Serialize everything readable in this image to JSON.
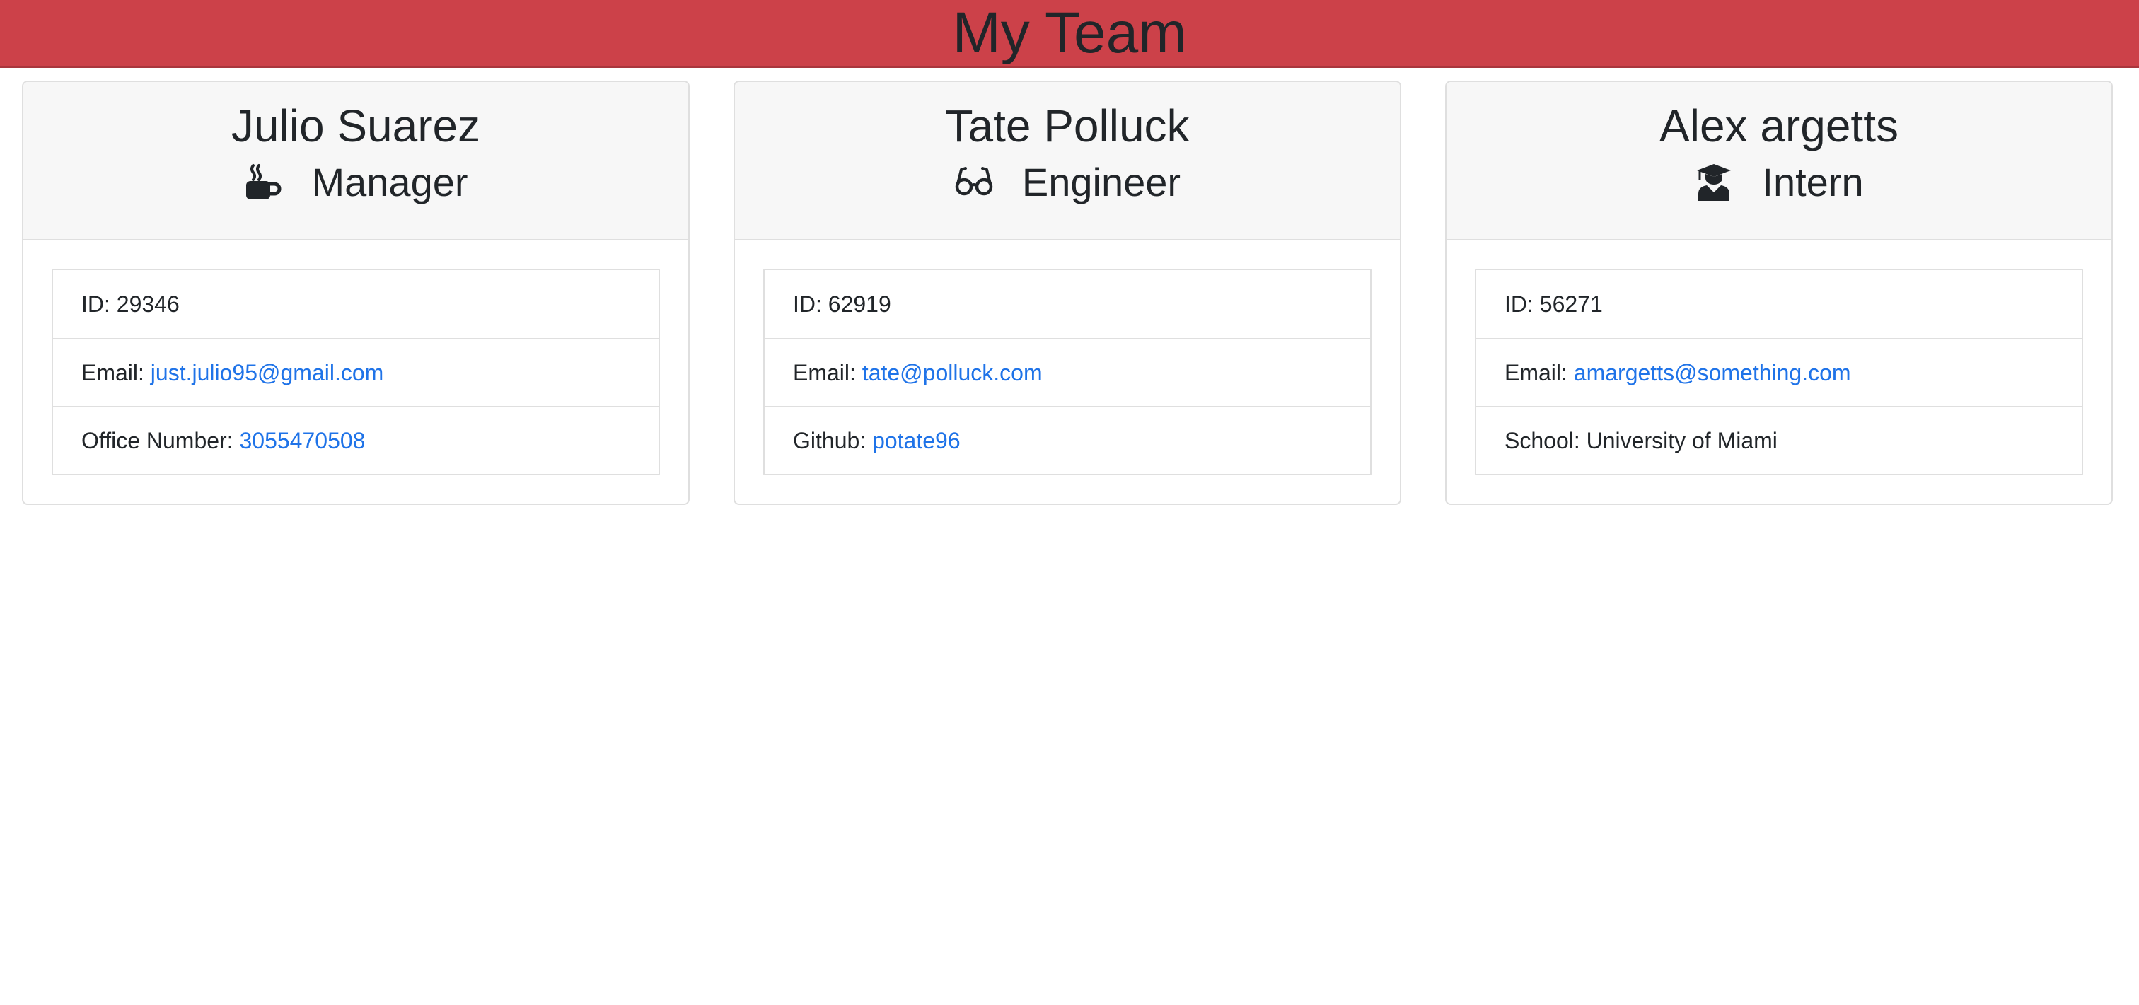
{
  "page": {
    "title": "My Team"
  },
  "colors": {
    "header_bg": "#cc4149",
    "link": "#1f73e8"
  },
  "employees": [
    {
      "name": "Julio Suarez",
      "role": "Manager",
      "icon": "coffee-mug-icon",
      "id_label": "ID:",
      "id": "29346",
      "email_label": "Email:",
      "email": "just.julio95@gmail.com",
      "extra_label": "Office Number:",
      "extra_value": "3055470508"
    },
    {
      "name": "Tate Polluck",
      "role": "Engineer",
      "icon": "glasses-icon",
      "id_label": "ID:",
      "id": "62919",
      "email_label": "Email:",
      "email": "tate@polluck.com",
      "extra_label": "Github:",
      "extra_value": "potate96"
    },
    {
      "name": "Alex argetts",
      "role": "Intern",
      "icon": "graduate-icon",
      "id_label": "ID:",
      "id": "56271",
      "email_label": "Email:",
      "email": "amargetts@something.com",
      "extra_label": "School:",
      "extra_value": "University of Miami"
    }
  ]
}
